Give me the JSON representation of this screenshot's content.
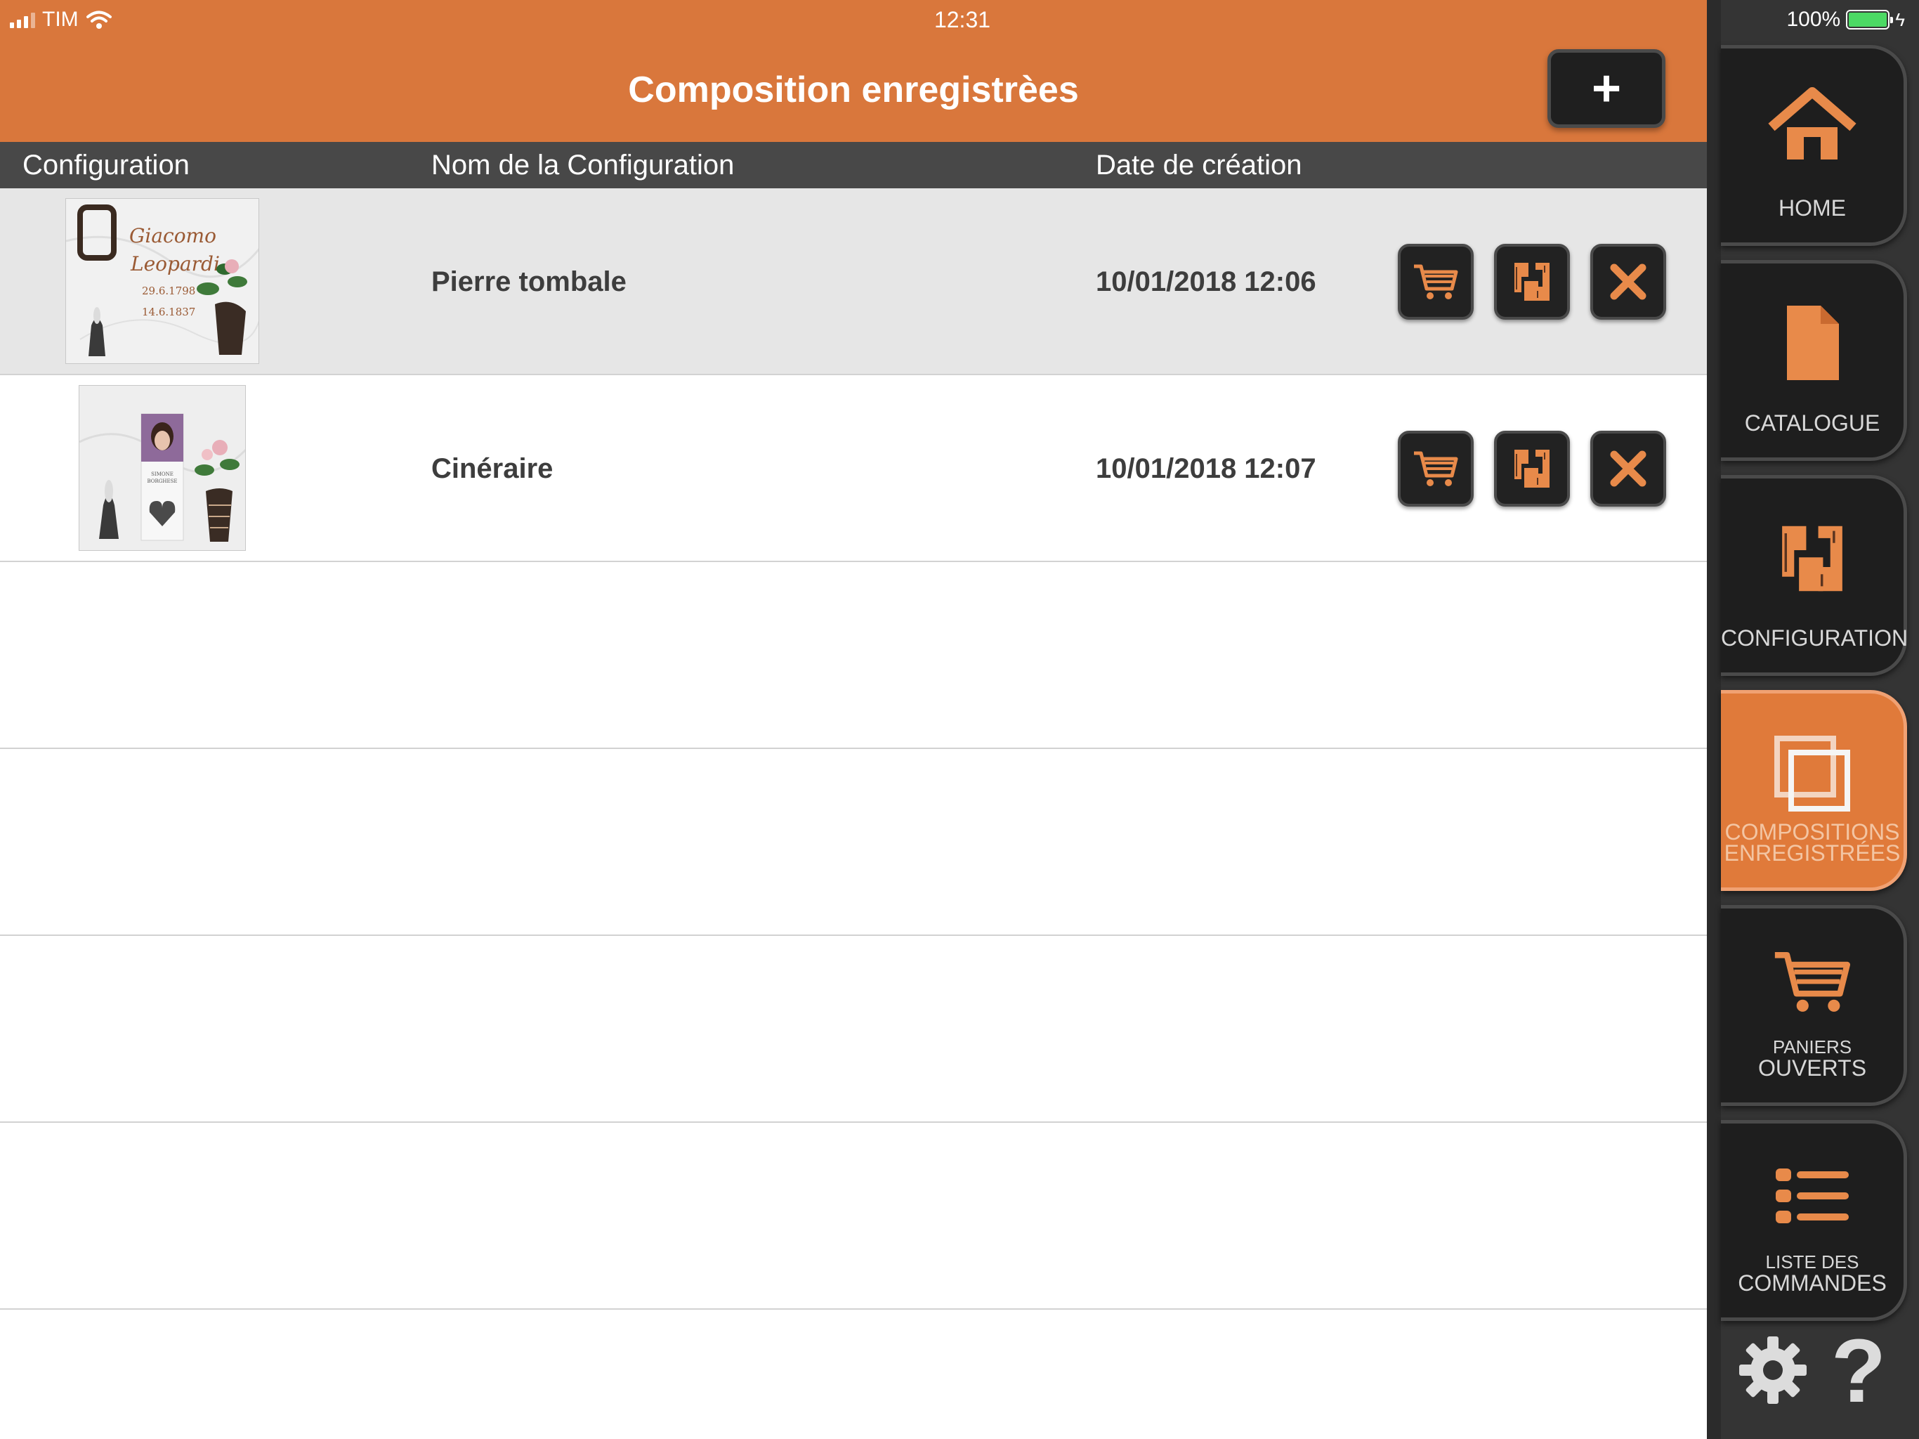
{
  "status": {
    "carrier": "TIM",
    "time": "12:31",
    "battery": "100%"
  },
  "header": {
    "title": "Composition enregistrèes",
    "add_label": "+"
  },
  "columns": {
    "configuration": "Configuration",
    "name": "Nom de la Configuration",
    "date": "Date de création"
  },
  "rows": [
    {
      "name": "Pierre tombale",
      "date": "10/01/2018 12:06",
      "thumb": {
        "line1": "Giacomo",
        "line2": "Leopardi",
        "line3": "29.6.1798",
        "line4": "14.6.1837"
      }
    },
    {
      "name": "Cinéraire",
      "date": "10/01/2018 12:07",
      "thumb": {
        "line1": "SIMONE",
        "line2": "BORGHESE"
      }
    }
  ],
  "sidebar": {
    "items": [
      {
        "line1": "",
        "line2": "HOME",
        "icon": "home-icon"
      },
      {
        "line1": "",
        "line2": "CATALOGUE",
        "icon": "document-icon"
      },
      {
        "line1": "",
        "line2": "CONFIGURATION",
        "icon": "configuration-icon"
      },
      {
        "line1": "COMPOSITIONS",
        "line2": "ENREGISTRÉES",
        "icon": "compositions-icon",
        "active": true
      },
      {
        "line1": "PANIERS",
        "line2": "OUVERTS",
        "icon": "cart-icon"
      },
      {
        "line1": "LISTE DES",
        "line2": "COMMANDES",
        "icon": "list-icon"
      }
    ],
    "help_label": "?"
  },
  "colors": {
    "accent": "#d9773c",
    "header_bar": "#484848",
    "sidebar_bg": "#343434",
    "button_bg": "#222222",
    "icon_orange": "#e88a4a"
  }
}
